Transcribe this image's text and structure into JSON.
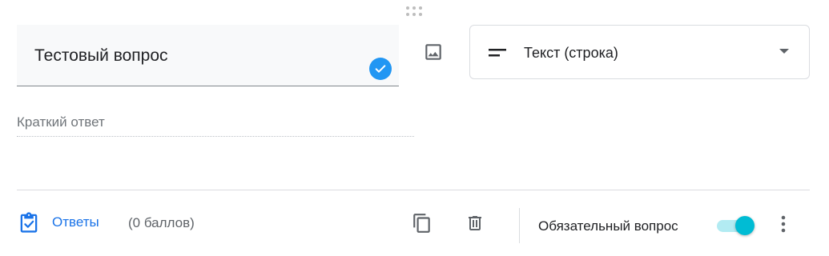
{
  "question": {
    "title": "Тестовый вопрос",
    "answer_placeholder": "Краткий ответ"
  },
  "type_select": {
    "selected": "Текст (строка)",
    "icon": "short-text-icon"
  },
  "footer": {
    "answers_label": "Ответы",
    "points": "(0 баллов)",
    "required_label": "Обязательный вопрос",
    "required_on": true
  },
  "colors": {
    "accent_blue": "#1a73e8",
    "toggle_thumb": "#00bcd4",
    "toggle_track": "#b2ebf2",
    "check_badge": "#2196f3"
  },
  "icons": [
    "drag-handle-icon",
    "check-circle-icon",
    "image-icon",
    "short-text-icon",
    "dropdown-arrow-icon",
    "answer-key-icon",
    "copy-icon",
    "delete-icon",
    "more-vert-icon"
  ]
}
